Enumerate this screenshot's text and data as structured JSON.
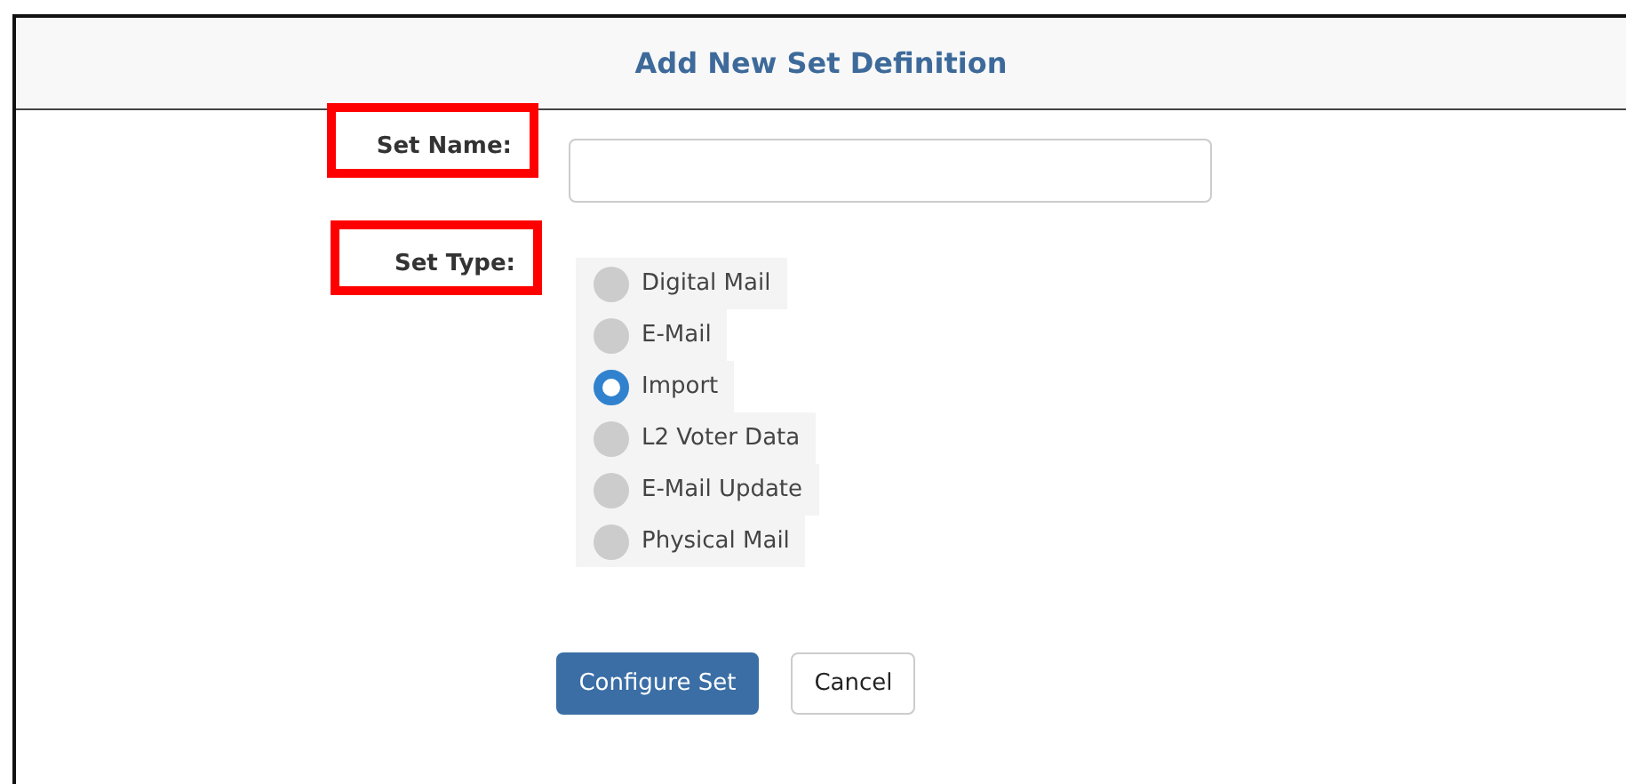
{
  "dialog": {
    "title": "Add New Set Definition"
  },
  "set_name": {
    "label": "Set Name:",
    "highlighted": true
  },
  "set_type": {
    "label": "Set Type:",
    "highlighted": true,
    "options": [
      {
        "label": "Digital Mail",
        "selected": false
      },
      {
        "label": "E-Mail",
        "selected": false
      },
      {
        "label": "Import",
        "selected": true
      },
      {
        "label": "L2 Voter Data",
        "selected": false
      },
      {
        "label": "E-Mail Update",
        "selected": false
      },
      {
        "label": "Physical Mail",
        "selected": false
      }
    ]
  },
  "buttons": [
    {
      "label": "Configure Set",
      "kind": "primary"
    },
    {
      "label": "Cancel",
      "kind": "default"
    }
  ]
}
